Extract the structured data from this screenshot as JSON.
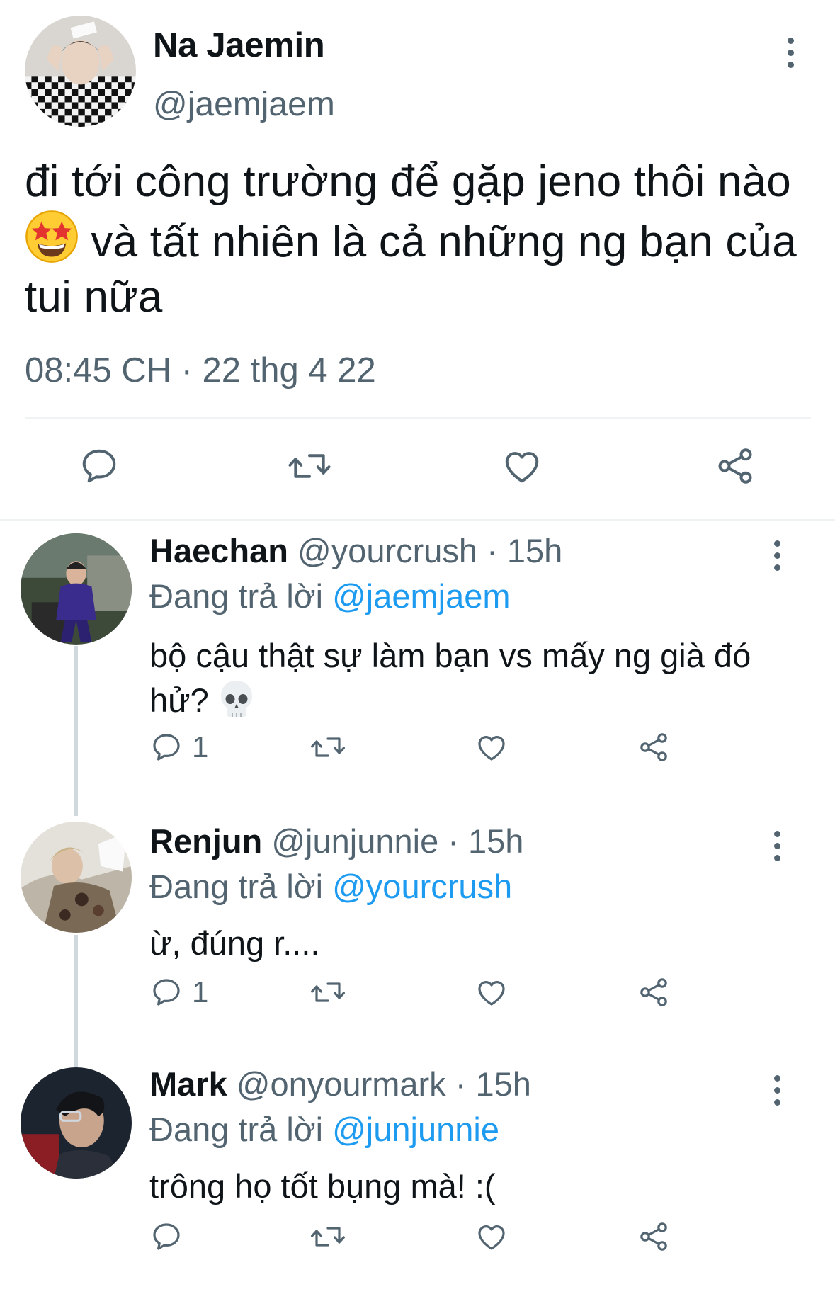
{
  "main_tweet": {
    "author_name": "Na Jaemin",
    "author_handle": "@jaemjaem",
    "text_before_emoji": "đi tới công trường để gặp jeno thôi nào ",
    "text_after_emoji": " và tất nhiên là cả những ng bạn của tui nữa",
    "emoji": "star-struck",
    "timestamp": "08:45 CH · 22 thg 4 22",
    "actions": [
      "reply-icon",
      "retweet-icon",
      "like-icon",
      "share-icon"
    ]
  },
  "replies": [
    {
      "author_name": "Haechan",
      "author_handle": "@yourcrush",
      "time": "· 15h",
      "replying_label": "Đang trả lời ",
      "replying_to": "@jaemjaem",
      "text": "bộ cậu thật sự làm bạn vs mấy ng già đó hử? ",
      "emoji": "skull",
      "reply_count": "1"
    },
    {
      "author_name": "Renjun",
      "author_handle": "@junjunnie",
      "time": "· 15h",
      "replying_label": "Đang trả lời ",
      "replying_to": "@yourcrush",
      "text": "ừ, đúng r....",
      "reply_count": "1"
    },
    {
      "author_name": "Mark",
      "author_handle": "@onyourmark",
      "time": "· 15h",
      "replying_label": "Đang trả lời ",
      "replying_to": "@junjunnie",
      "text": "trông họ tốt bụng mà! :(",
      "reply_count": ""
    }
  ],
  "colors": {
    "text": "#0f1419",
    "secondary": "#536471",
    "mention": "#1d9bf0",
    "divider": "#eff3f4",
    "thread_line": "#cfd9de"
  }
}
